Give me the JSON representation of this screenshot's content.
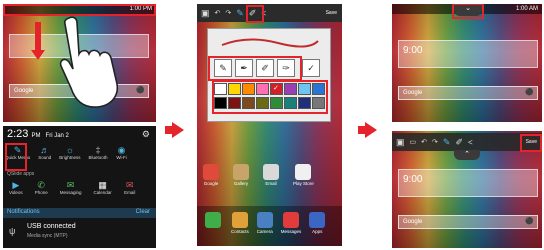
{
  "colors": {
    "accent_red": "#e5232b",
    "quick_icon_blue": "#4fb3e3"
  },
  "step1": {
    "status_time": "1:00 PM",
    "search_label": "Google",
    "notification_shade": {
      "time": "2:23",
      "time_suffix": "PM",
      "date": "Fri Jan 2",
      "quick_settings": [
        {
          "label": "Quick Memo",
          "icon": "memo-icon"
        },
        {
          "label": "Sound",
          "icon": "sound-icon"
        },
        {
          "label": "Brightness",
          "icon": "brightness-icon"
        },
        {
          "label": "Bluetooth",
          "icon": "bluetooth-icon"
        },
        {
          "label": "Wi-Fi",
          "icon": "wifi-icon"
        }
      ],
      "qslide_label": "QSlide apps",
      "qslide_apps": [
        "Videos",
        "Phone",
        "Messaging",
        "Calendar",
        "Email"
      ],
      "notifications_label": "Notifications",
      "clear_label": "Clear",
      "notification_title": "USB connected",
      "notification_sub": "Media sync (MTP)"
    }
  },
  "step2": {
    "save_label": "Save",
    "dock_apps": [
      "Google",
      "Gallery",
      "Email",
      "Play Store"
    ],
    "bottom_apps": [
      "Contacts",
      "Camera",
      "Messages",
      "Apps"
    ]
  },
  "step3": {
    "status_time": "1:00 AM",
    "clock_top": "9:00",
    "clock_bottom": "9:00",
    "search_label": "Google",
    "save_label": "Save"
  }
}
